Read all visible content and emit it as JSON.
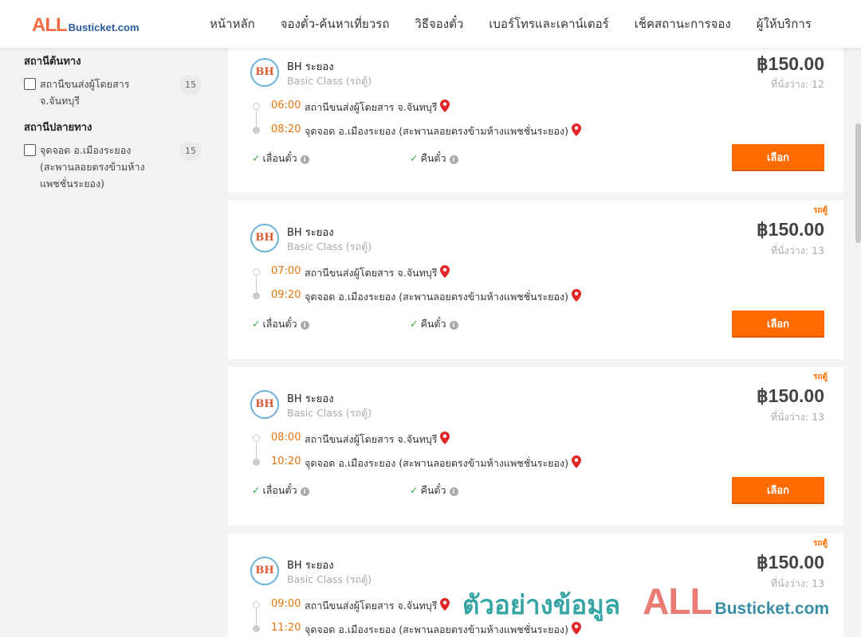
{
  "header": {
    "logo_all": "ALL",
    "logo_bus": "Busticket.com",
    "nav": [
      "หน้าหลัก",
      "จองตั๋ว-ค้นหาเที่ยวรถ",
      "วิธีจองตั๋ว",
      "เบอร์โทรและเคาน์เตอร์",
      "เช็คสถานะการจอง",
      "ผู้ให้บริการ"
    ]
  },
  "sidebar": {
    "origin_title": "สถานีต้นทาง",
    "origin_label": "สถานีขนส่งผู้โดยสาร จ.จันทบุรี",
    "origin_count": "15",
    "dest_title": "สถานีปลายทาง",
    "dest_label": "จุดจอด อ.เมืองระยอง (สะพานลอยตรงข้ามห้างแพชชั่นระยอง)",
    "dest_count": "15"
  },
  "colors": {
    "accent": "#ff6b00",
    "time": "#e8740c",
    "check": "#2eaa3a",
    "pin": "#e02626"
  },
  "trips": [
    {
      "logo": "BH",
      "operator": "BH ระยอง",
      "class": "Basic Class (รถตู้)",
      "price": "฿150.00",
      "seats": "ที่นั่งว่าง: 12",
      "tag": "",
      "dep_time": "06:00",
      "dep_stop": "สถานีขนส่งผู้โดยสาร จ.จันทบุรี",
      "arr_time": "08:20",
      "arr_stop": "จุดจอด อ.เมืองระยอง (สะพานลอยตรงข้ามห้างแพชชั่นระยอง)",
      "feature1": "เลื่อนตั๋ว",
      "feature2": "คืนตั๋ว",
      "button": "เลือก"
    },
    {
      "logo": "BH",
      "operator": "BH ระยอง",
      "class": "Basic Class (รถตู้)",
      "price": "฿150.00",
      "seats": "ที่นั่งว่าง: 13",
      "tag": "รถตู้",
      "dep_time": "07:00",
      "dep_stop": "สถานีขนส่งผู้โดยสาร จ.จันทบุรี",
      "arr_time": "09:20",
      "arr_stop": "จุดจอด อ.เมืองระยอง (สะพานลอยตรงข้ามห้างแพชชั่นระยอง)",
      "feature1": "เลื่อนตั๋ว",
      "feature2": "คืนตั๋ว",
      "button": "เลือก"
    },
    {
      "logo": "BH",
      "operator": "BH ระยอง",
      "class": "Basic Class (รถตู้)",
      "price": "฿150.00",
      "seats": "ที่นั่งว่าง: 13",
      "tag": "รถตู้",
      "dep_time": "08:00",
      "dep_stop": "สถานีขนส่งผู้โดยสาร จ.จันทบุรี",
      "arr_time": "10:20",
      "arr_stop": "จุดจอด อ.เมืองระยอง (สะพานลอยตรงข้ามห้างแพชชั่นระยอง)",
      "feature1": "เลื่อนตั๋ว",
      "feature2": "คืนตั๋ว",
      "button": "เลือก"
    },
    {
      "logo": "BH",
      "operator": "BH ระยอง",
      "class": "Basic Class (รถตู้)",
      "price": "฿150.00",
      "seats": "ที่นั่งว่าง: 13",
      "tag": "รถตู้",
      "dep_time": "09:00",
      "dep_stop": "สถานีขนส่งผู้โดยสาร จ.จันทบุรี",
      "arr_time": "11:20",
      "arr_stop": "จุดจอด อ.เมืองระยอง (สะพานลอยตรงข้ามห้างแพชชั่นระยอง)",
      "feature1": "",
      "feature2": "",
      "button": ""
    }
  ],
  "watermark": {
    "thai": "ตัวอย่างข้อมูล",
    "all": "ALL",
    "bus": "Busticket.com"
  }
}
